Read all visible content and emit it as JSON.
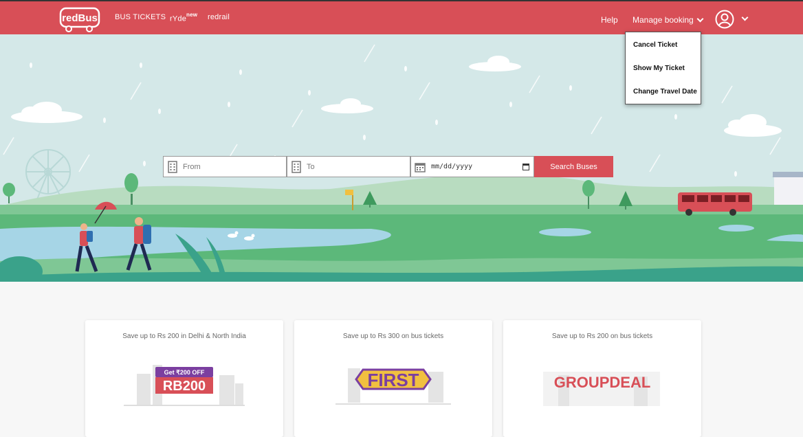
{
  "nav": {
    "logo": "redBus",
    "bus_tickets": "BUS TICKETS",
    "ryde": "rYde",
    "ryde_badge": "new",
    "redrail": "redrail",
    "help": "Help",
    "manage_booking": "Manage booking"
  },
  "manage_menu": [
    "Cancel Ticket",
    "Show My Ticket",
    "Change Travel Date"
  ],
  "search": {
    "from_placeholder": "From",
    "to_placeholder": "To",
    "date_value": "mm/dd/yyyy",
    "button_label": "Search Buses"
  },
  "offers": [
    {
      "caption": "Save up to Rs 200 in Delhi & North India",
      "badge": "Get ₹200 OFF",
      "code": "RB200"
    },
    {
      "caption": "Save up to Rs 300 on bus tickets",
      "code": "FIRST"
    },
    {
      "caption": "Save up to Rs 200 on bus tickets",
      "code": "GROUPDEAL"
    }
  ],
  "colors": {
    "brand": "#d84f57",
    "sky": "#d4e8e8",
    "grass": "#5cb87a",
    "water": "#a6d5e6"
  }
}
